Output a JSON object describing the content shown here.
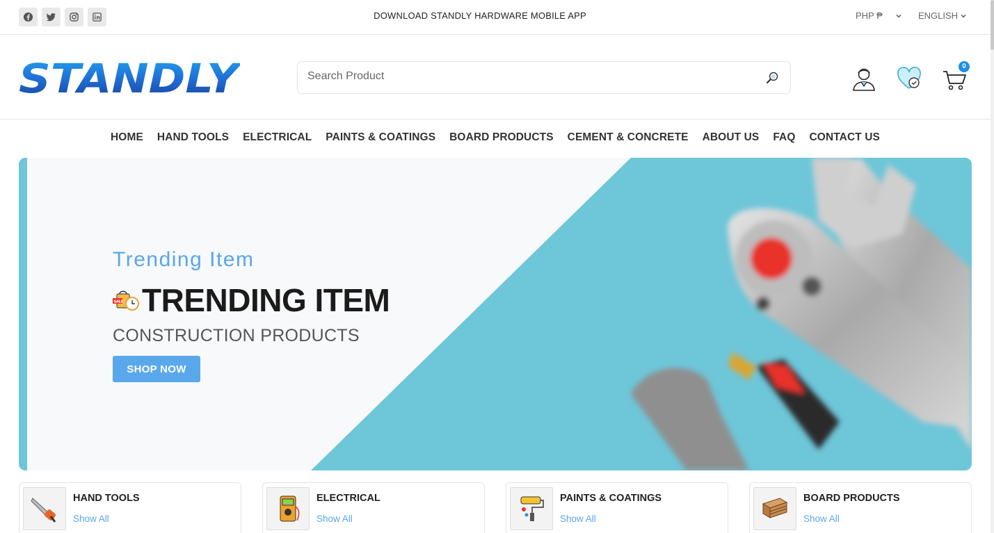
{
  "topbar": {
    "social_icons": [
      "facebook-icon",
      "twitter-icon",
      "instagram-icon",
      "linkedin-icon"
    ],
    "promo_text": "DOWNLOAD STANDLY HARDWARE MOBILE APP",
    "currency": "PHP ₱",
    "language": "ENGLISH"
  },
  "header": {
    "logo_text": "STANDLY",
    "search_placeholder": "Search Product",
    "cart_count": "0",
    "icons": [
      "user-icon",
      "wishlist-icon",
      "cart-icon"
    ]
  },
  "nav": {
    "items": [
      "HOME",
      "HAND TOOLS",
      "ELECTRICAL",
      "PAINTS & COATINGS",
      "BOARD PRODUCTS",
      "CEMENT & CONCRETE",
      "ABOUT US",
      "FAQ",
      "CONTACT US"
    ]
  },
  "hero": {
    "subtitle": "Trending Item",
    "title": "TRENDING ITEM",
    "description": "CONSTRUCTION PRODUCTS",
    "button": "SHOP NOW"
  },
  "categories": [
    {
      "title": "HAND TOOLS",
      "link": "Show All"
    },
    {
      "title": "ELECTRICAL",
      "link": "Show All"
    },
    {
      "title": "PAINTS & COATINGS",
      "link": "Show All"
    },
    {
      "title": "BOARD PRODUCTS",
      "link": "Show All"
    }
  ],
  "colors": {
    "accent": "#5aa8ec",
    "hero_bg": "#6ec6d9",
    "badge": "#1e8fe6"
  }
}
